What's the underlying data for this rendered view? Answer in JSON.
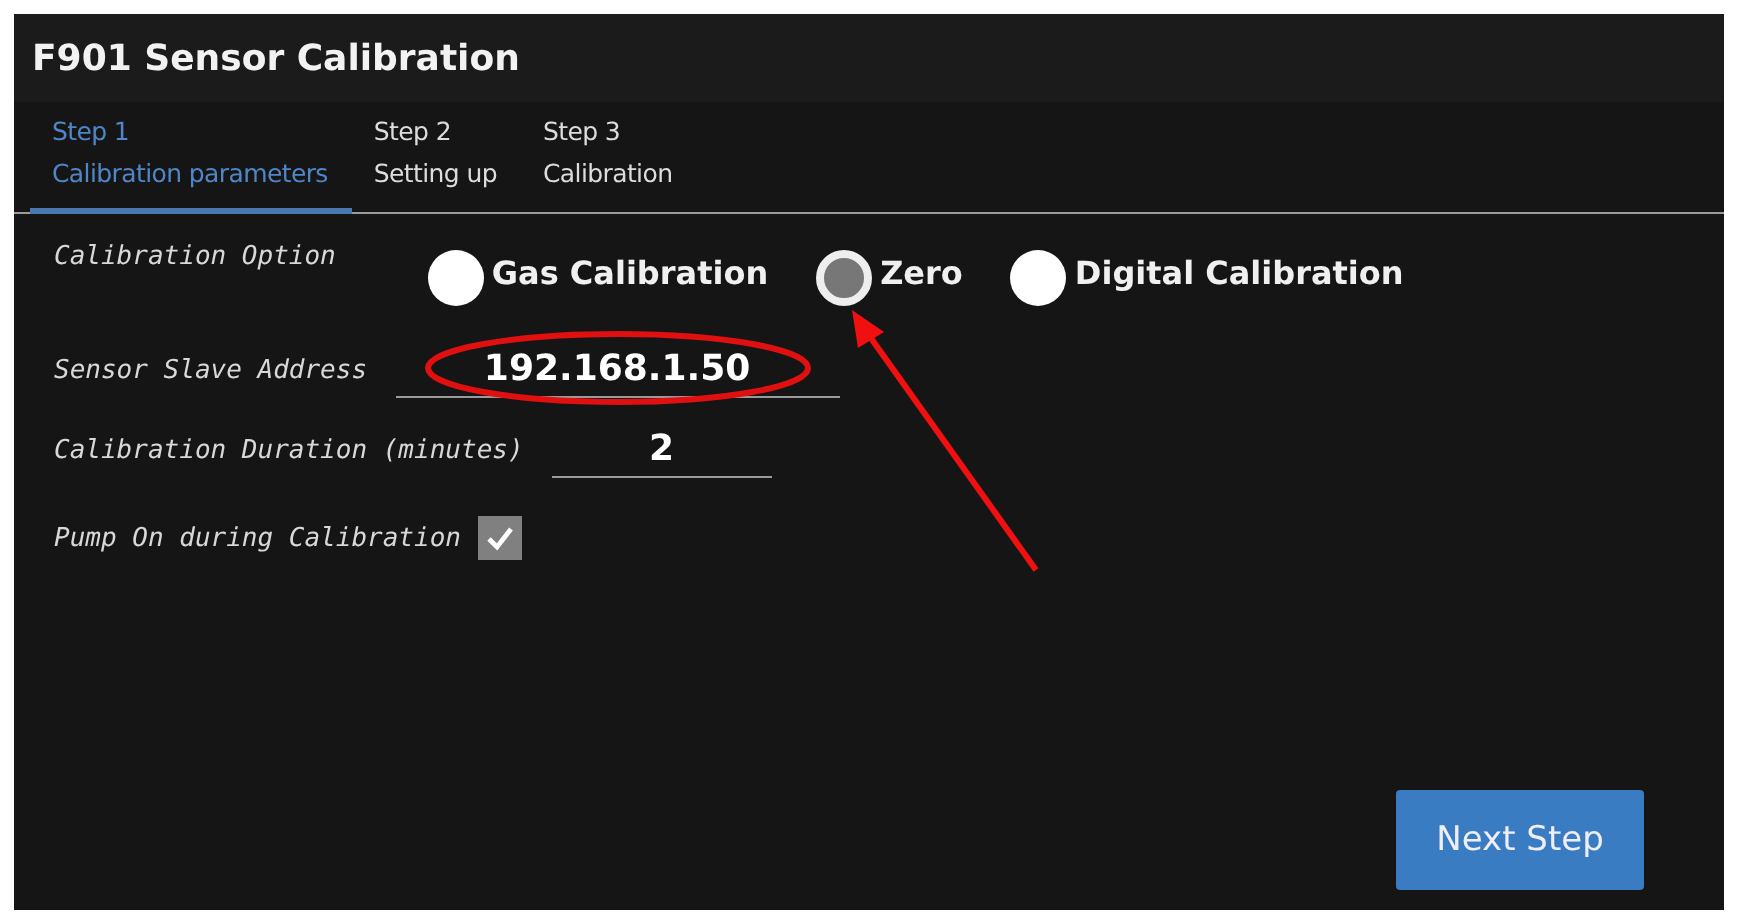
{
  "window": {
    "title": "F901 Sensor Calibration"
  },
  "tabs": [
    {
      "step": "Step 1",
      "label": "Calibration parameters",
      "selected": true
    },
    {
      "step": "Step 2",
      "label": "Setting up",
      "selected": false
    },
    {
      "step": "Step 3",
      "label": "Calibration",
      "selected": false
    }
  ],
  "calibration_option": {
    "label": "Calibration Option",
    "options": [
      {
        "label": "Gas Calibration",
        "selected": false
      },
      {
        "label": "Zero",
        "selected": true,
        "arrow": true
      },
      {
        "label": "Digital Calibration",
        "selected": false
      }
    ]
  },
  "fields": [
    {
      "label": "Sensor Slave Address",
      "value": "192.168.1.50",
      "kind": "wide",
      "circled": true
    },
    {
      "label": "Calibration Duration (minutes)",
      "value": "2",
      "kind": "narrow"
    }
  ],
  "pump": {
    "label": "Pump On during Calibration",
    "checked": true
  },
  "buttons": [
    {
      "label": "Next Step"
    }
  ]
}
